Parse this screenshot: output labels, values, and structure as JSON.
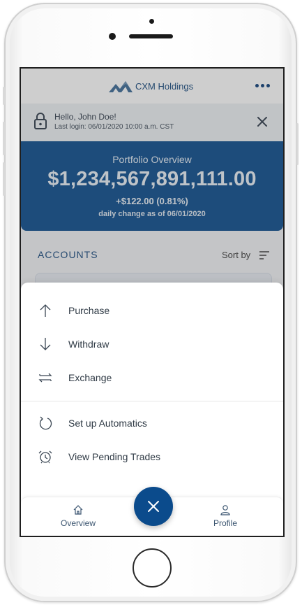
{
  "header": {
    "brand_name": "CXM Holdings",
    "logo_icon": "mountain-logo-icon",
    "menu_icon": "more-horizontal-icon"
  },
  "notice": {
    "greeting": "Hello, John Doe!",
    "last_login": "Last login: 06/01/2020 10:00 a.m. CST",
    "lock_icon": "lock-icon",
    "close_icon": "close-icon"
  },
  "portfolio": {
    "title": "Portfolio Overview",
    "total": "$1,234,567,891,111.00",
    "change": "+$122.00 (0.81%)",
    "daily_note": "daily change as of 06/01/2020"
  },
  "accounts": {
    "title": "ACCOUNTS",
    "sort_label": "Sort by",
    "sort_icon": "sort-icon"
  },
  "actions": {
    "items": [
      {
        "label": "Purchase",
        "icon": "arrow-up-icon"
      },
      {
        "label": "Withdraw",
        "icon": "arrow-down-icon"
      },
      {
        "label": "Exchange",
        "icon": "exchange-icon"
      },
      {
        "label": "Set up Automatics",
        "icon": "refresh-icon"
      },
      {
        "label": "View Pending Trades",
        "icon": "alarm-clock-icon"
      }
    ]
  },
  "tabbar": {
    "overview_label": "Overview",
    "profile_label": "Profile",
    "overview_icon": "home-icon",
    "profile_icon": "user-icon",
    "fab_icon": "close-icon"
  },
  "colors": {
    "brand_blue": "#0b4b8c",
    "brand_text": "#13467c",
    "label_text": "#2f3a45"
  }
}
